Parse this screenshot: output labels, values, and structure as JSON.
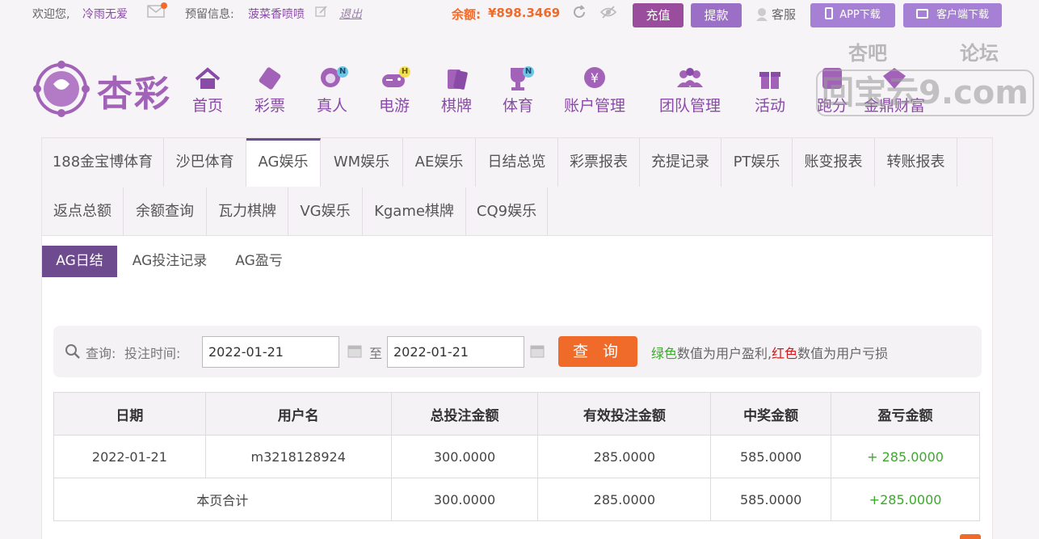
{
  "topbar": {
    "welcome": "欢迎您,",
    "username": "冷雨无爱",
    "reserve_label": "预留信息:",
    "reserve_value": "菠菜香喷喷",
    "logout": "退出",
    "balance_label": "余额:",
    "balance_value": "¥898.3469",
    "recharge": "充值",
    "withdraw": "提款",
    "service": "客服",
    "app_download": "APP下载",
    "client_download": "客户端下载"
  },
  "logo": {
    "text": "杏彩"
  },
  "nav": {
    "items": [
      {
        "label": "首页",
        "icon": "home-icon"
      },
      {
        "label": "彩票",
        "icon": "ticket-icon"
      },
      {
        "label": "真人",
        "icon": "dealer-icon",
        "badge": "N"
      },
      {
        "label": "电游",
        "icon": "gamepad-icon",
        "badge": "H"
      },
      {
        "label": "棋牌",
        "icon": "cards-icon"
      },
      {
        "label": "体育",
        "icon": "trophy-icon",
        "badge": "N"
      },
      {
        "label": "账户管理",
        "icon": "yen-icon"
      },
      {
        "label": "团队管理",
        "icon": "team-icon"
      },
      {
        "label": "活动",
        "icon": "gift-icon"
      },
      {
        "label": "跑分",
        "icon": "run-icon"
      },
      {
        "label": "金鼎财富",
        "icon": "wealth-icon"
      }
    ]
  },
  "watermark": {
    "line1a": "杏吧",
    "line1b": "论坛",
    "line2": "回宝云9.com"
  },
  "tabs": {
    "row1": [
      "188金宝博体育",
      "沙巴体育",
      "AG娱乐",
      "WM娱乐",
      "AE娱乐",
      "日结总览",
      "彩票报表",
      "充提记录",
      "PT娱乐",
      "账变报表",
      "转账报表"
    ],
    "row2": [
      "返点总额",
      "余额查询",
      "瓦力棋牌",
      "VG娱乐",
      "Kgame棋牌",
      "CQ9娱乐"
    ],
    "active": "AG娱乐"
  },
  "subtabs": [
    "AG日结",
    "AG投注记录",
    "AG盈亏"
  ],
  "search": {
    "query_label": "查询:",
    "time_label": "投注时间:",
    "start_date": "2022-01-21",
    "to": "至",
    "end_date": "2022-01-21",
    "button": "查 询",
    "hint_green": "绿色",
    "hint_mid": "数值为用户盈利,",
    "hint_red": "红色",
    "hint_end": "数值为用户亏损"
  },
  "table": {
    "headers": [
      "日期",
      "用户名",
      "总投注金额",
      "有效投注金额",
      "中奖金额",
      "盈亏金额"
    ],
    "rows": [
      [
        "2022-01-21",
        "m3218128924",
        "300.0000",
        "285.0000",
        "585.0000",
        "+ 285.0000"
      ]
    ],
    "total": [
      "本页合计",
      "300.0000",
      "285.0000",
      "585.0000",
      "+285.0000"
    ]
  }
}
